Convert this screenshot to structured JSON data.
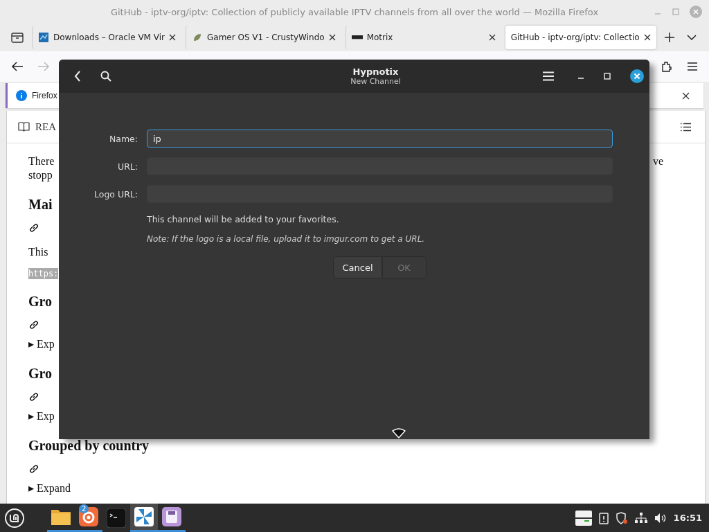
{
  "window": {
    "title": "GitHub - iptv-org/iptv: Collection of publicly available IPTV channels from all over the world — Mozilla Firefox"
  },
  "tabs": [
    {
      "label": "Downloads – Oracle VM Vir",
      "selected": false
    },
    {
      "label": "Gamer OS V1 - CrustyWindo",
      "selected": false
    },
    {
      "label": "Motrix",
      "selected": false
    },
    {
      "label": "GitHub - iptv-org/iptv: Collectio",
      "selected": true
    }
  ],
  "notification": {
    "text": "Firefox"
  },
  "readme": {
    "tab": "REA"
  },
  "article": [
    {
      "kind": "paragraph",
      "lines": [
        "There",
        "stopp"
      ],
      "tail": "ve"
    },
    {
      "kind": "heading",
      "text": "Mai"
    },
    {
      "kind": "anchor"
    },
    {
      "kind": "text",
      "text": "This"
    },
    {
      "kind": "code",
      "text": "https:"
    },
    {
      "kind": "heading",
      "text": "Gro"
    },
    {
      "kind": "anchor"
    },
    {
      "kind": "expand",
      "text": "▸ Exp"
    },
    {
      "kind": "heading",
      "text": "Gro"
    },
    {
      "kind": "anchor"
    },
    {
      "kind": "expand",
      "text": "▸ Exp"
    },
    {
      "kind": "heading",
      "text": "Grouped by country"
    },
    {
      "kind": "anchor"
    },
    {
      "kind": "expand",
      "text": "▸ Expand"
    }
  ],
  "dialog": {
    "title": "Hypnotix",
    "subtitle": "New Channel",
    "fields": [
      {
        "label": "Name:",
        "value": "ip",
        "focused": true
      },
      {
        "label": "URL:",
        "focused": false
      },
      {
        "label": "Logo URL:",
        "focused": false
      }
    ],
    "info": "This channel will be added to your favorites.",
    "note": "Note: If the logo is a local file, upload it to imgur.com to get a URL.",
    "buttons": [
      {
        "label": "Cancel",
        "disabled": false
      },
      {
        "label": "OK",
        "disabled": true
      }
    ]
  },
  "taskbar": {
    "apps": [
      {
        "running": true,
        "active": false
      },
      {
        "badge": "2",
        "running": true,
        "active": false
      },
      {
        "running": false,
        "active": false
      },
      {
        "running": true,
        "active": true
      },
      {
        "running": true,
        "active": false
      }
    ],
    "clock": "16:51"
  }
}
